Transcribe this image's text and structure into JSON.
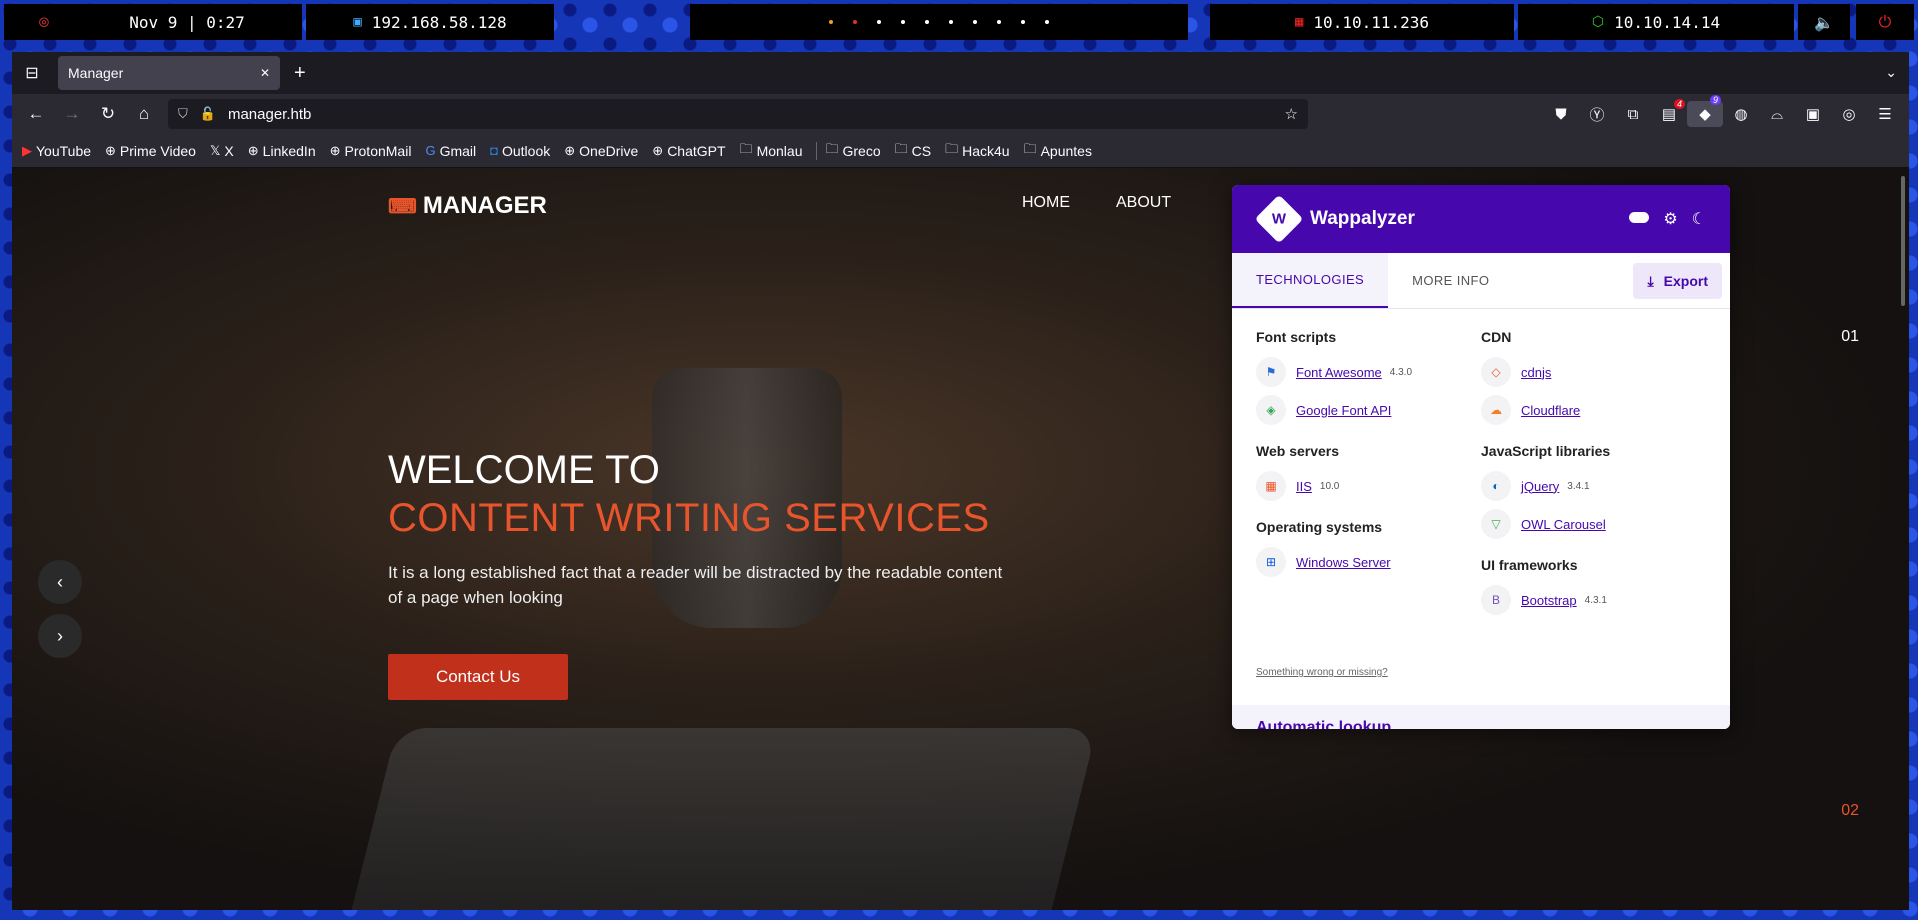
{
  "topbar": {
    "clock": "Nov 9 | 0:27",
    "local_ip": "192.168.58.128",
    "target_ip": "10.10.11.236",
    "vpn_ip": "10.10.14.14"
  },
  "browser": {
    "tab_title": "Manager",
    "url": "manager.htb",
    "bookmarks": [
      "YouTube",
      "Prime Video",
      "X",
      "LinkedIn",
      "ProtonMail",
      "Gmail",
      "Outlook",
      "OneDrive",
      "ChatGPT",
      "Monlau"
    ],
    "bookmark_folders": [
      "Greco",
      "CS",
      "Hack4u",
      "Apuntes"
    ],
    "ext_badge_red": "4",
    "ext_badge_wap": "9"
  },
  "site": {
    "logo": "MANAGER",
    "nav": [
      "HOME",
      "ABOUT"
    ],
    "hero_line1": "WELCOME TO",
    "hero_line2": "CONTENT WRITING SERVICES",
    "hero_text": "It is a long established fact that a reader will be distracted by the readable content of a page when looking",
    "cta": "Contact Us",
    "slide1": "01",
    "slide2": "02"
  },
  "wappalyzer": {
    "title": "Wappalyzer",
    "tabs": [
      "TECHNOLOGIES",
      "MORE INFO"
    ],
    "export_label": "Export",
    "left": [
      {
        "category": "Font scripts",
        "items": [
          {
            "name": "Font Awesome",
            "version": "4.3.0",
            "icon": "flag-icon"
          },
          {
            "name": "Google Font API",
            "version": "",
            "icon": "google-fonts-icon"
          }
        ]
      },
      {
        "category": "Web servers",
        "items": [
          {
            "name": "IIS",
            "version": "10.0",
            "icon": "iis-icon"
          }
        ]
      },
      {
        "category": "Operating systems",
        "items": [
          {
            "name": "Windows Server",
            "version": "",
            "icon": "windows-icon"
          }
        ]
      }
    ],
    "right": [
      {
        "category": "CDN",
        "items": [
          {
            "name": "cdnjs",
            "version": "",
            "icon": "cdnjs-icon"
          },
          {
            "name": "Cloudflare",
            "version": "",
            "icon": "cloudflare-icon"
          }
        ]
      },
      {
        "category": "JavaScript libraries",
        "items": [
          {
            "name": "jQuery",
            "version": "3.4.1",
            "icon": "jquery-icon"
          },
          {
            "name": "OWL Carousel",
            "version": "",
            "icon": "owl-icon"
          }
        ]
      },
      {
        "category": "UI frameworks",
        "items": [
          {
            "name": "Bootstrap",
            "version": "4.3.1",
            "icon": "bootstrap-icon"
          }
        ]
      }
    ],
    "footer_link": "Something wrong or missing?",
    "bottom_text": "Automatic lookup"
  }
}
